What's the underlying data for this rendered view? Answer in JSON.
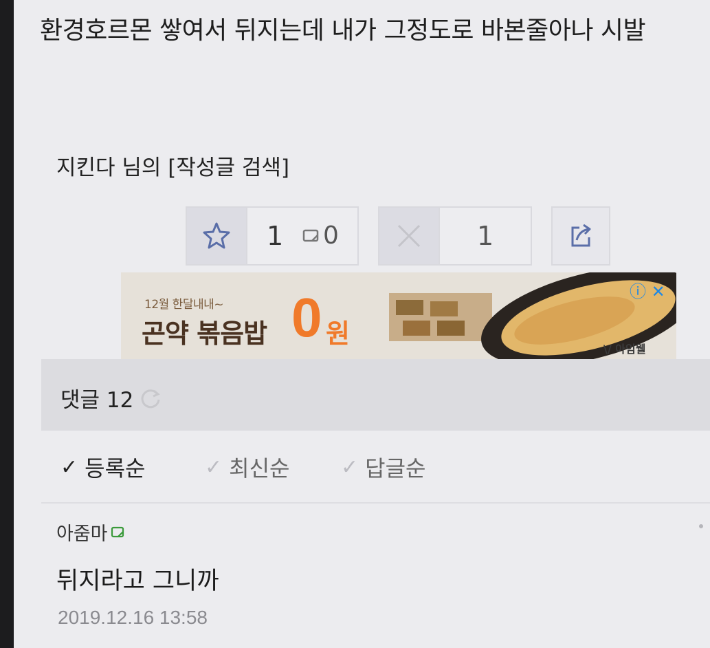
{
  "post": {
    "title": "환경호르몬 쌓여서 뒤지는데 내가 그정도로 바본줄아나 시발",
    "author_line": "지킨다 님의 [작성글 검색]"
  },
  "votes": {
    "like_count": "1",
    "scrap_count": "0",
    "dislike_count": "1"
  },
  "ad": {
    "small_text": "12월 한달내내~",
    "main_text": "곤약 볶음밥",
    "zero": "0",
    "won": "원",
    "brand": "\\/ 아임웰",
    "info_symbols": "ⓘ ✕"
  },
  "comments": {
    "title": "댓글 12",
    "sort": [
      {
        "label": "등록순",
        "active": true
      },
      {
        "label": "최신순",
        "active": false
      },
      {
        "label": "답글순",
        "active": false
      }
    ],
    "items": [
      {
        "author": "아줌마",
        "text": "뒤지라고 그니까",
        "date": "2019.12.16 13:58"
      }
    ]
  },
  "colors": {
    "background": "#ececef",
    "accent_orange": "#f07a2a",
    "icon_blue": "#5a6ea8"
  },
  "icons": [
    "star-icon",
    "scrap-icon",
    "close-icon",
    "share-icon",
    "refresh-icon",
    "check-icon",
    "memo-icon"
  ]
}
